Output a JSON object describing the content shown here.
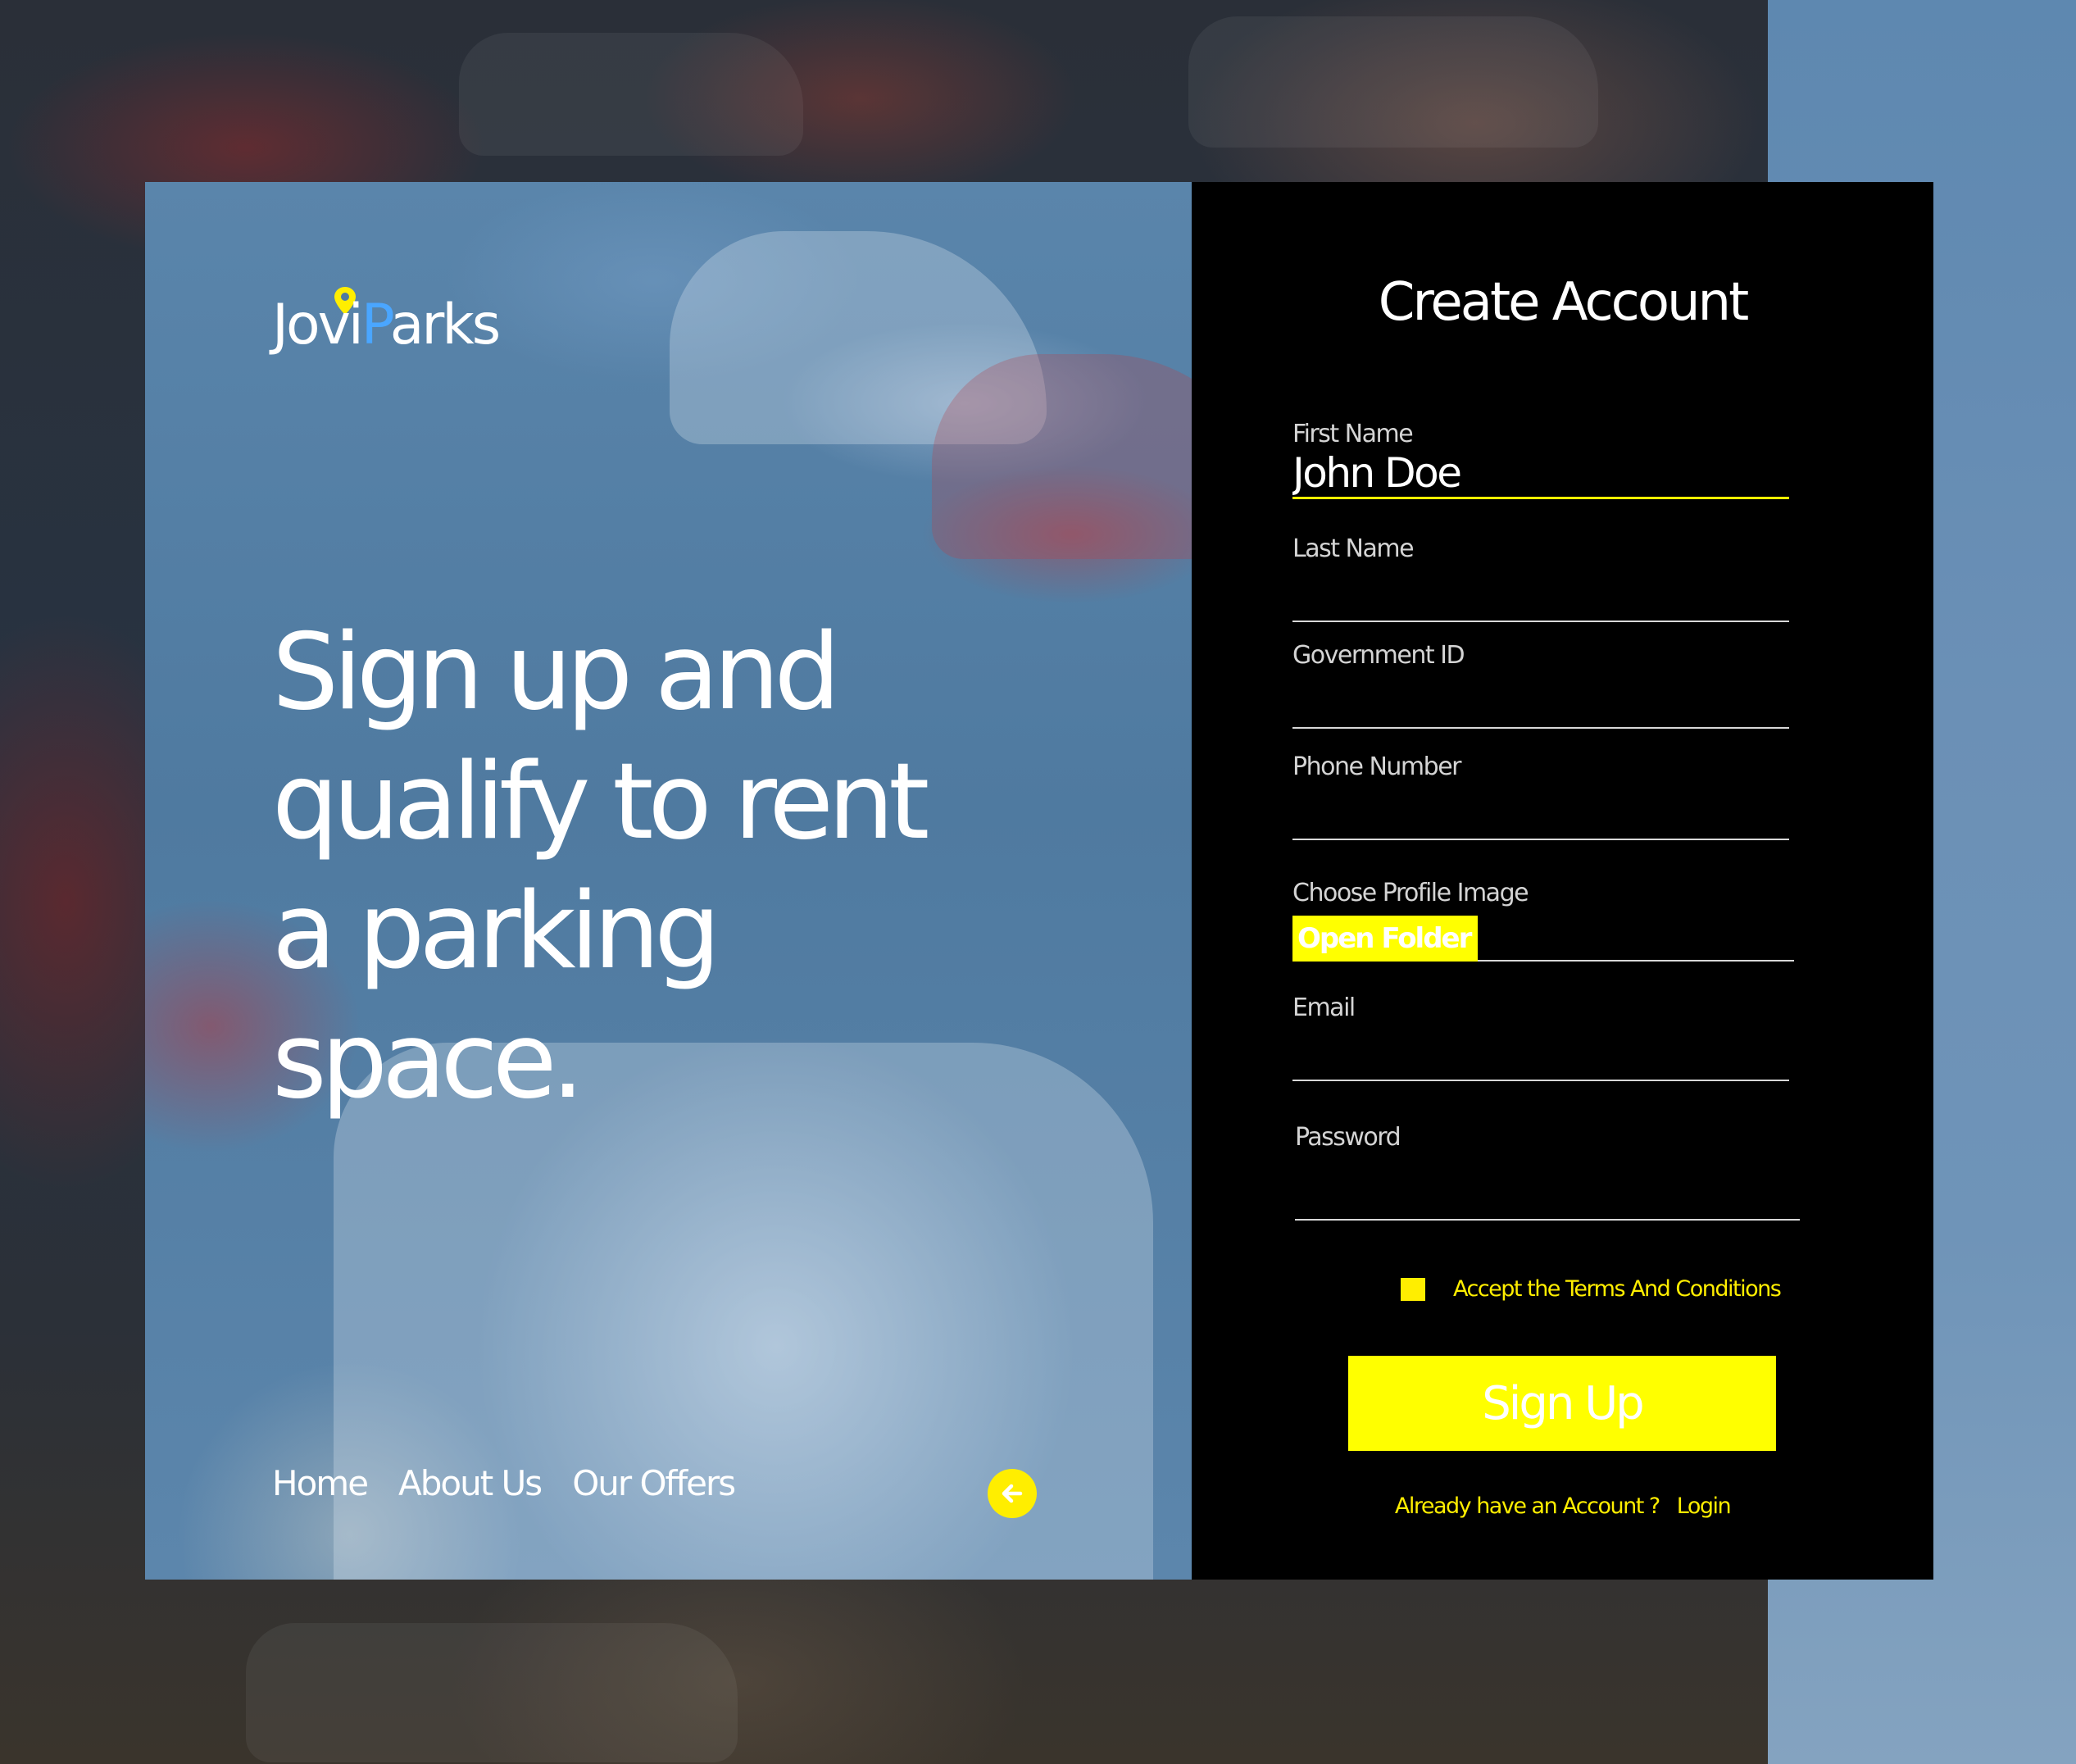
{
  "brand": {
    "part1": "Jovi",
    "part2": "P",
    "part3": "arks"
  },
  "hero": {
    "headline": "Sign up and qualify to rent a parking space."
  },
  "nav": {
    "items": [
      {
        "label": "Home"
      },
      {
        "label": "About Us"
      },
      {
        "label": "Our Offers"
      }
    ],
    "back_icon": "arrow-left-icon"
  },
  "form": {
    "title": "Create Account",
    "first_name": {
      "label": "First Name",
      "value": "John Doe"
    },
    "last_name": {
      "label": "Last Name",
      "value": ""
    },
    "government_id": {
      "label": "Government ID",
      "value": ""
    },
    "phone": {
      "label": "Phone Number",
      "value": ""
    },
    "profile_image": {
      "label": "Choose Profile Image",
      "button": "Open Folder"
    },
    "email": {
      "label": "Email",
      "value": ""
    },
    "password": {
      "label": "Password",
      "value": ""
    },
    "terms_label": "Accept the Terms And Conditions",
    "submit_label": "Sign Up",
    "login_prompt": "Already have an Account ?",
    "login_link": "Login"
  },
  "colors": {
    "accent": "#ffee00",
    "brand_blue": "#4aa6ff",
    "panel": "#000000"
  }
}
